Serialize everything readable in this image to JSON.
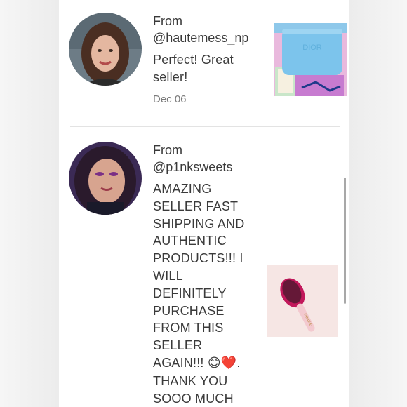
{
  "reviews": [
    {
      "from_label": "From",
      "handle": "@hautemess_np",
      "message": "Perfect! Great seller!",
      "date": "Dec 06",
      "avatar_icon": "woman-avatar-icon",
      "thumbnail_icon": "blue-pouch-product-icon"
    },
    {
      "from_label": "From",
      "handle": "@p1nksweets",
      "message_lines": [
        "AMAZING",
        "SELLER FAST",
        "SHIPPING AND",
        "AUTHENTIC",
        "PRODUCTS!!! I",
        "WILL",
        "DEFINITELY",
        "PURCHASE",
        "FROM THIS",
        "SELLER"
      ],
      "message_last_pre": "AGAIN!!! ",
      "emoji_smile": "😊",
      "emoji_heart": "❤️",
      "message_last_post": ".",
      "message_tail": [
        "THANK YOU",
        "SOOO MUCH"
      ],
      "avatar_icon": "woman-avatar-icon",
      "thumbnail_icon": "hair-brush-product-icon"
    }
  ],
  "colors": {
    "text": "#3a3a3a",
    "date": "#7a7a7a",
    "divider": "#e3e3e3",
    "pouch_blue": "#7cc4ec",
    "brush_pink": "#c2185b"
  }
}
